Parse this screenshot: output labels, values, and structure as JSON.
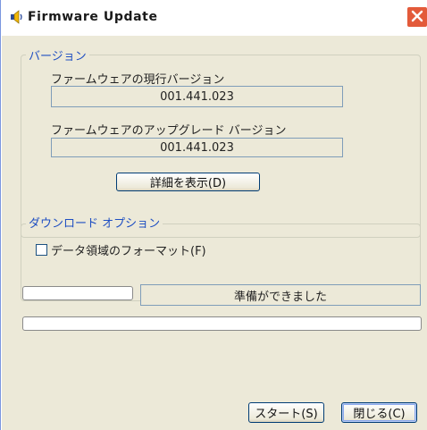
{
  "window": {
    "title": "Firmware Update",
    "icon": "speaker-icon",
    "close_icon": "close-icon"
  },
  "version_group": {
    "legend": "バージョン",
    "current_label": "ファームウェアの現行バージョン",
    "current_value": "001.441.023",
    "upgrade_label": "ファームウェアのアップグレード バージョン",
    "upgrade_value": "001.441.023",
    "details_button": "詳細を表示(D)"
  },
  "download_group": {
    "legend": "ダウンロード オプション",
    "format_checkbox_label": "データ領域のフォーマット(F)",
    "format_checked": false
  },
  "status": {
    "text": "準備ができました",
    "progress_small": 0,
    "progress_main": 0
  },
  "buttons": {
    "start": "スタート(S)",
    "close": "閉じる(C)"
  },
  "colors": {
    "accent_legend": "#1f4fc2",
    "close_button": "#e35a3a",
    "dialog_background": "#ece9d8"
  }
}
